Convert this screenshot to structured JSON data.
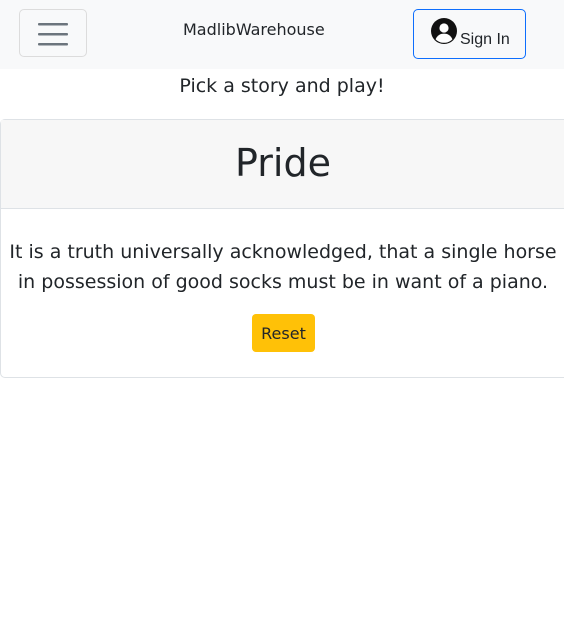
{
  "navbar": {
    "toggle_icon": "hamburger-menu-icon",
    "brand": "MadlibWarehouse",
    "signin_icon": "user-circle-icon",
    "signin_label": "Sign In",
    "signin_border_color": "#0d6efd"
  },
  "main": {
    "subtitle": "Pick a story and play!"
  },
  "story_card": {
    "title": "Pride",
    "text_line1": "It is a truth universally acknowledged, that a single horse",
    "text_line2": "in possession of good socks must be in want of a piano.",
    "reset_label": "Reset",
    "reset_color": "#ffc107"
  }
}
